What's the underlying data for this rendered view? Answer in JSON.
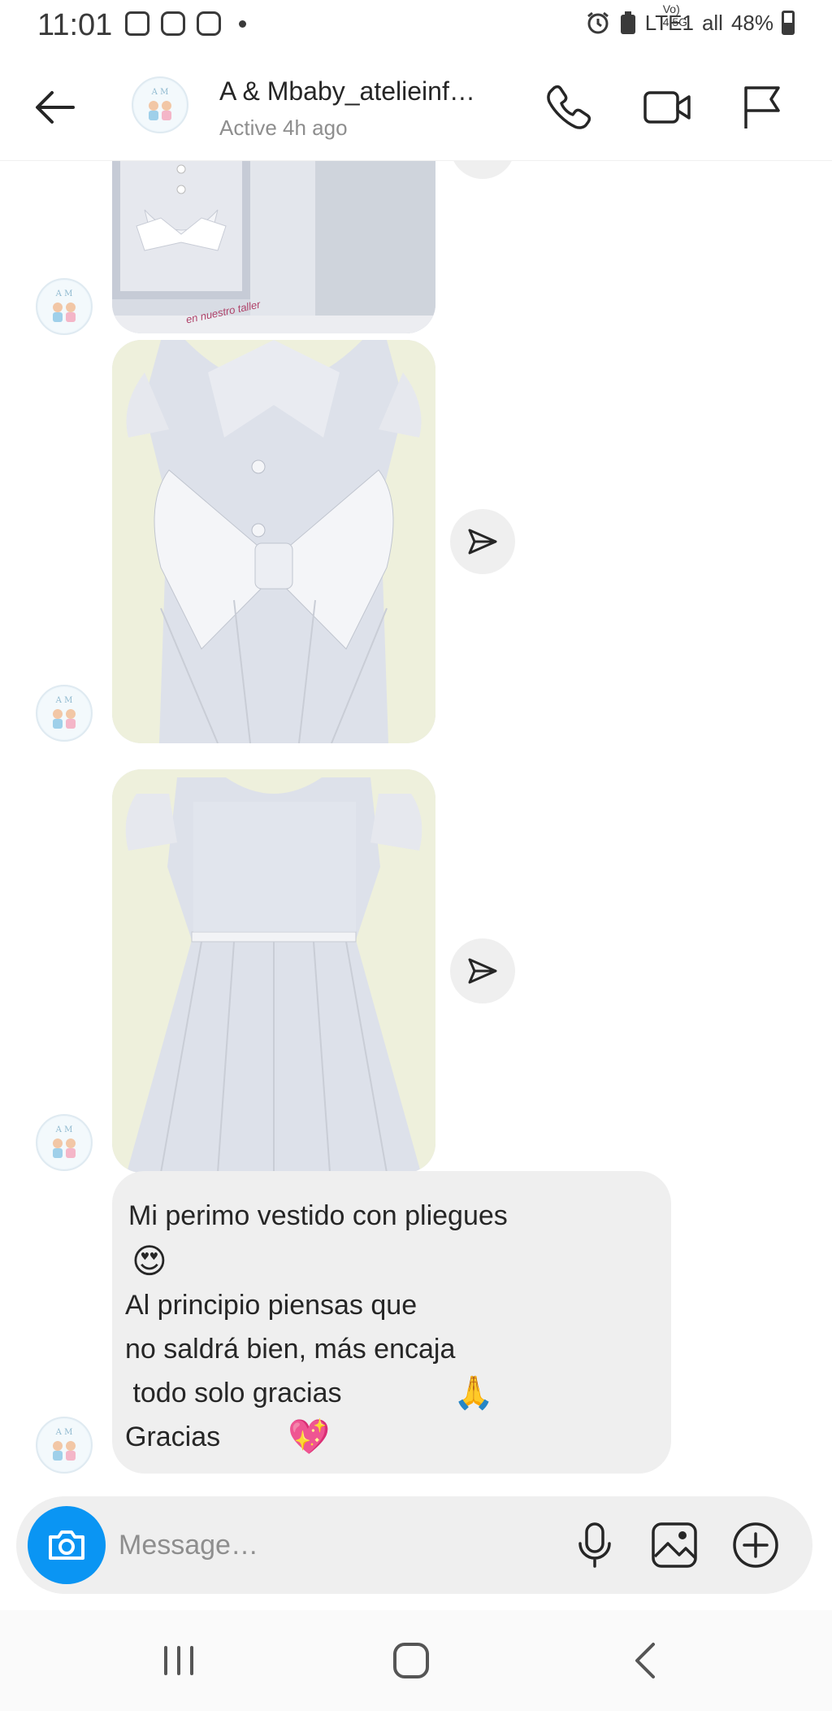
{
  "status_bar": {
    "time": "11:01",
    "network_text": "LTE1",
    "network_small": "Vo) 4.5G",
    "signal_text": "all",
    "battery": "48%"
  },
  "header": {
    "title": "A & Mbaby_atelieinf…",
    "subtitle": "Active 4h ago"
  },
  "photos": [
    {
      "caption": "en nuestro taller"
    },
    {
      "caption": ""
    },
    {
      "caption": ""
    }
  ],
  "message": {
    "lines": [
      "Mi perimo vestido con pliegues",
      "Al principio piensas que",
      "no saldrá bien, más encaja",
      " todo solo gracias",
      "Gracias"
    ],
    "emojis": [
      "😍",
      "🙏",
      "💖"
    ]
  },
  "composer": {
    "placeholder": "Message…"
  },
  "colors": {
    "camera_button": "#0a95f3",
    "bubble": "#efefef",
    "secondary_text": "#8e8e8e"
  },
  "icons": [
    "back-arrow-icon",
    "phone-icon",
    "video-camera-icon",
    "flag-icon",
    "send-icon",
    "camera-icon",
    "microphone-icon",
    "gallery-icon",
    "plus-circle-icon"
  ]
}
